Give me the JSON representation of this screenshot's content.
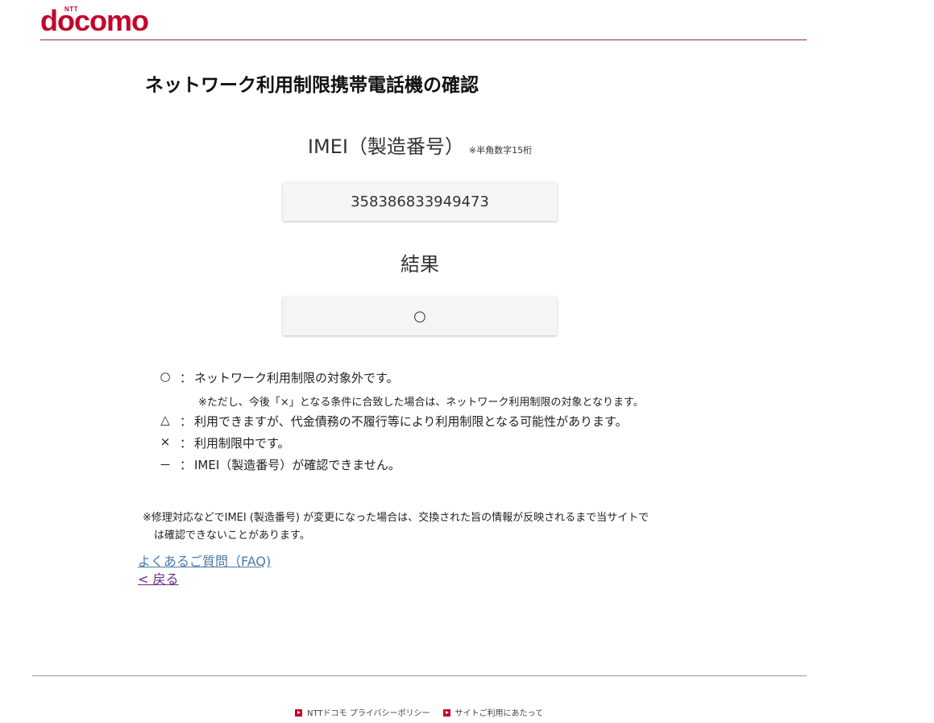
{
  "header": {
    "logo_ntt": "NTT",
    "logo_word": "docomo"
  },
  "main": {
    "title": "ネットワーク利用制限携帯電話機の確認",
    "imei_label": "IMEI（製造番号）",
    "imei_note": "※半角数字15桁",
    "imei_value": "358386833949473",
    "result_label": "結果",
    "result_value": "○"
  },
  "legend": {
    "colon": "：",
    "items": [
      {
        "symbol": "○",
        "text": "ネットワーク利用制限の対象外です。"
      },
      {
        "symbol": "△",
        "text": "利用できますが、代金債務の不履行等により利用制限となる可能性があります。"
      },
      {
        "symbol": "×",
        "text": "利用制限中です。"
      },
      {
        "symbol": "－",
        "text": "IMEI（製造番号）が確認できません。"
      }
    ],
    "sub_note": "※ただし、今後「×」となる条件に合致した場合は、ネットワーク利用制限の対象となります。"
  },
  "notes": {
    "repair_line1": "※修理対応などでIMEI (製造番号) が変更になった場合は、交換された旨の情報が反映されるまで当サイトで",
    "repair_line2": "は確認できないことがあります。"
  },
  "links": {
    "faq": "よくあるご質問（FAQ)",
    "back": "< 戻る"
  },
  "footer": {
    "privacy": "NTTドコモ プライバシーポリシー",
    "terms": "サイトご利用にあたって"
  },
  "colors": {
    "brand": "#c4032b",
    "link": "#4a7aa8",
    "visited_link": "#6a2a8a"
  }
}
